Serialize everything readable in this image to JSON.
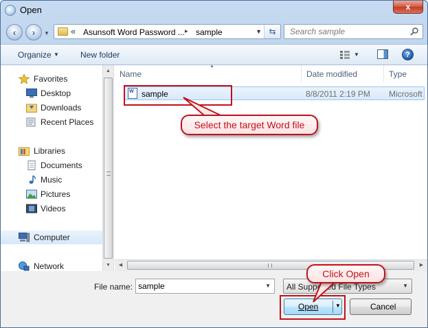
{
  "window": {
    "title": "Open",
    "close_symbol": "x"
  },
  "address": {
    "chevron": "«",
    "segment1": "Asunsoft Word Password ...",
    "separator": "▸",
    "segment2": "sample"
  },
  "search": {
    "placeholder": "Search sample"
  },
  "toolbar": {
    "organize": "Organize",
    "new_folder": "New folder",
    "help": "?"
  },
  "sidebar": {
    "favorites": {
      "label": "Favorites",
      "items": [
        "Desktop",
        "Downloads",
        "Recent Places"
      ]
    },
    "libraries": {
      "label": "Libraries",
      "items": [
        "Documents",
        "Music",
        "Pictures",
        "Videos"
      ]
    },
    "computer": "Computer",
    "network": "Network"
  },
  "columns": {
    "name": "Name",
    "date": "Date modified",
    "type": "Type"
  },
  "files": [
    {
      "name": "sample",
      "date": "8/8/2011 2:19 PM",
      "type": "Microsoft",
      "icon_label": "W"
    }
  ],
  "bottom": {
    "file_name_label": "File name:",
    "file_name_value": "sample",
    "file_type": "All Supported File Types",
    "open": "Open",
    "cancel": "Cancel"
  },
  "annotations": {
    "select_file": "Select the target Word file",
    "click_open": "Click Open"
  },
  "colors": {
    "annotation": "#c0111b",
    "selection": "#d9eafc"
  }
}
